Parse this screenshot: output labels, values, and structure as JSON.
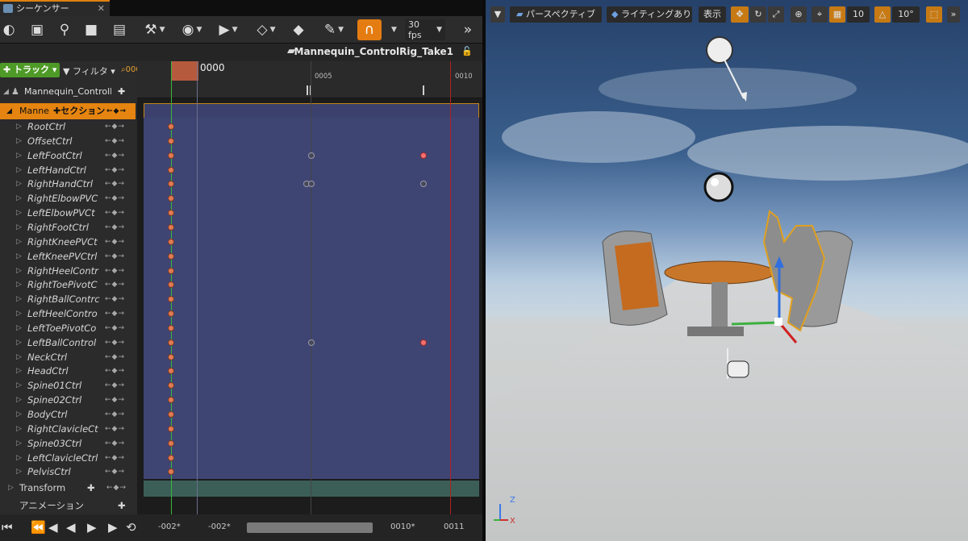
{
  "sequencer": {
    "tab_title": "シーケンサー",
    "toolbar": {
      "fps": "30 fps"
    },
    "sequence_name": "Mannequin_ControlRig_Take1",
    "track_button": "トラック",
    "filter_label": "フィルタ",
    "current_time_field": "0000",
    "current_time": "0000",
    "ruler_labels": [
      "0005",
      "0010"
    ],
    "object_row": "Mannequin_ControlR",
    "control_row": "Manne",
    "section_button": "セクション",
    "controls": [
      "RootCtrl",
      "OffsetCtrl",
      "LeftFootCtrl",
      "LeftHandCtrl",
      "RightHandCtrl",
      "RightElbowPVC",
      "LeftElbowPVCt",
      "RightFootCtrl",
      "RightKneePVCt",
      "LeftKneePVCtrl",
      "RightHeelContr",
      "RightToePivotC",
      "RightBallContrc",
      "LeftHeelContro",
      "LeftToePivotCo",
      "LeftBallControl",
      "NeckCtrl",
      "HeadCtrl",
      "Spine01Ctrl",
      "Spine02Ctrl",
      "BodyCtrl",
      "RightClavicleCt",
      "Spine03Ctrl",
      "LeftClavicleCtrl",
      "PelvisCtrl"
    ],
    "transform_row": "Transform",
    "animation_row": "アニメーション",
    "bottom": {
      "view_start": "-002*",
      "work_start": "-002*",
      "work_end": "0010*",
      "view_end": "0011"
    }
  },
  "viewport": {
    "perspective_button": "パースペクティブ",
    "lighting_button": "ライティングあり",
    "show_button": "表示",
    "grid_snap": "10",
    "rot_snap": "10°",
    "axis": {
      "z": "Z",
      "x": "X"
    }
  }
}
